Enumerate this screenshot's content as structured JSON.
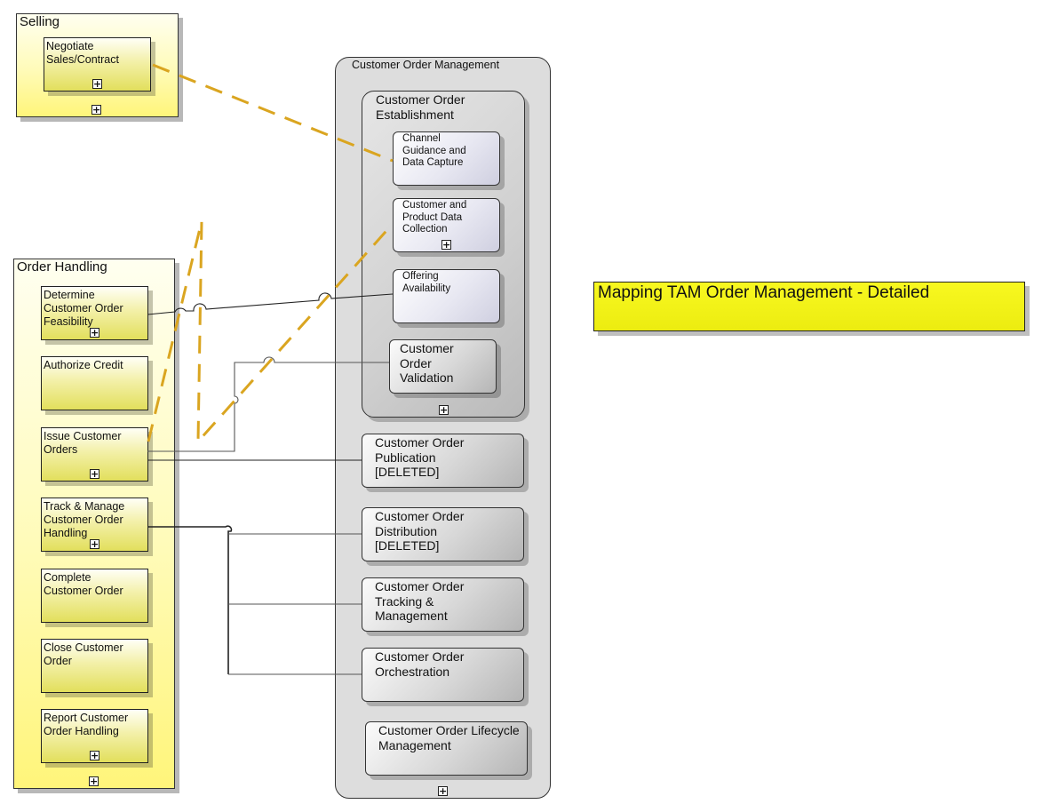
{
  "diagram": {
    "title": "Mapping TAM Order Management - Detailed",
    "expand_glyph": "+",
    "colors": {
      "mapping_dashed": "#daa520",
      "connector": "#222222",
      "yellow_group": "#fff57a",
      "gray_container": "#dddddd",
      "lavender_box": "#e8e8f2",
      "title_note": "#f0f015"
    }
  },
  "selling": {
    "title": "Selling",
    "items": [
      {
        "label": "Negotiate Sales/Contract",
        "expandable": true
      }
    ]
  },
  "order_handling": {
    "title": "Order Handling",
    "items": [
      {
        "label": "Determine Customer Order Feasibility",
        "expandable": true
      },
      {
        "label": "Authorize Credit",
        "expandable": false
      },
      {
        "label": "Issue Customer Orders",
        "expandable": true
      },
      {
        "label": "Track & Manage Customer Order Handling",
        "expandable": true
      },
      {
        "label": "Complete Customer Order",
        "expandable": false
      },
      {
        "label": "Close Customer Order",
        "expandable": false
      },
      {
        "label": "Report Customer Order Handling",
        "expandable": true
      }
    ]
  },
  "com": {
    "title": "Customer Order Management",
    "establishment": {
      "title": "Customer Order Establishment",
      "items": [
        {
          "label": "Channel Guidance and Data Capture",
          "expandable": false
        },
        {
          "label": "Customer and Product Data Collection",
          "expandable": true
        },
        {
          "label": "Offering Availability",
          "expandable": false
        },
        {
          "label": "Customer Order Validation",
          "expandable": false
        }
      ]
    },
    "items": [
      {
        "label": "Customer Order Publication [DELETED]"
      },
      {
        "label": "Customer Order Distribution [DELETED]"
      },
      {
        "label": "Customer Order Tracking & Management"
      },
      {
        "label": "Customer Order Orchestration"
      },
      {
        "label": "Customer Order Lifecycle Management"
      }
    ]
  },
  "mappings": [
    {
      "from": "Negotiate Sales/Contract",
      "to": "Channel Guidance and Data Capture",
      "style": "dashed"
    },
    {
      "from": "Issue Customer Orders",
      "to": "Customer and Product Data Collection",
      "style": "dashed"
    },
    {
      "from": "Determine Customer Order Feasibility",
      "to": "Offering Availability",
      "style": "solid"
    },
    {
      "from": "Issue Customer Orders",
      "to": "Customer Order Validation",
      "style": "solid"
    },
    {
      "from": "Issue Customer Orders",
      "to": "Customer Order Publication [DELETED]",
      "style": "solid"
    },
    {
      "from": "Track & Manage Customer Order Handling",
      "to": "Customer Order Distribution [DELETED]",
      "style": "solid"
    },
    {
      "from": "Track & Manage Customer Order Handling",
      "to": "Customer Order Tracking & Management",
      "style": "solid"
    },
    {
      "from": "Track & Manage Customer Order Handling",
      "to": "Customer Order Orchestration",
      "style": "solid"
    }
  ]
}
